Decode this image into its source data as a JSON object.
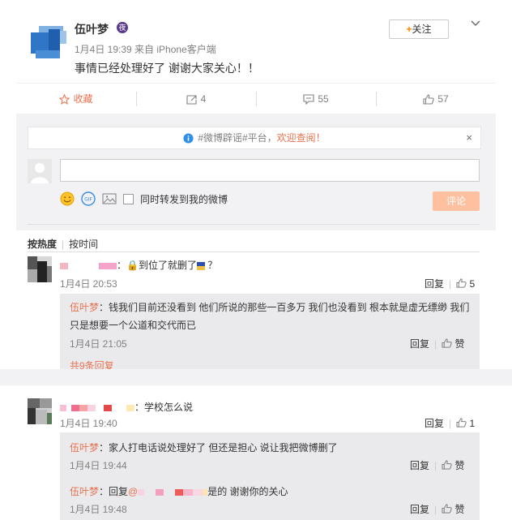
{
  "post": {
    "author": "伍叶梦",
    "vip_badge": "夜",
    "meta": "1月4日 19:39 来自 iPhone客户端",
    "text": "事情已经处理好了 谢谢大家关心！！",
    "follow_plus": "+",
    "follow_label": "关注"
  },
  "actions": {
    "favorite": "收藏",
    "repost": "4",
    "comment": "55",
    "like": "57"
  },
  "notice": {
    "prefix": "#微博辟谣#平台，",
    "highlight": "欢迎查阅！",
    "close": "×"
  },
  "composer": {
    "input_value": "",
    "repost_label": "同时转发到我的微博",
    "submit": "评论"
  },
  "sort": {
    "by_hot": "按热度",
    "by_time": "按时间"
  },
  "comments": [
    {
      "text": "：🔒到位了就删了",
      "tail": "？",
      "time": "1月4日 20:53",
      "reply": "回复",
      "likes": "5",
      "replies": [
        {
          "author": "伍叶梦",
          "text_line1": "：钱我们目前还没看到 他们所说的那些一百多万 我们也没看到 根本就是虚无缥缈 我们",
          "text_line2": "只是想要一个公道和交代而已",
          "time": "1月4日 21:05",
          "reply": "回复",
          "like": "赞"
        }
      ],
      "more": "共9条回复"
    },
    {
      "text": "：学校怎么说",
      "time": "1月4日 19:40",
      "reply": "回复",
      "likes": "1",
      "replies": [
        {
          "author": "伍叶梦",
          "text_line1": "：家人打电话说处理好了 但还是担心 说让我把微博删了",
          "time": "1月4日 19:44",
          "reply": "回复",
          "like": "赞"
        },
        {
          "author": "伍叶梦",
          "reply_to_prefix": "：回复",
          "reply_to_at": "@",
          "text_line1": "是的 谢谢你的关心",
          "time": "1月4日 19:48",
          "reply": "回复",
          "like": "赞"
        }
      ]
    }
  ],
  "colors": {
    "accent": "#eb7350",
    "follow_plus": "#ff8200",
    "panel_bg": "#f2f2f5",
    "muted": "#808080"
  }
}
